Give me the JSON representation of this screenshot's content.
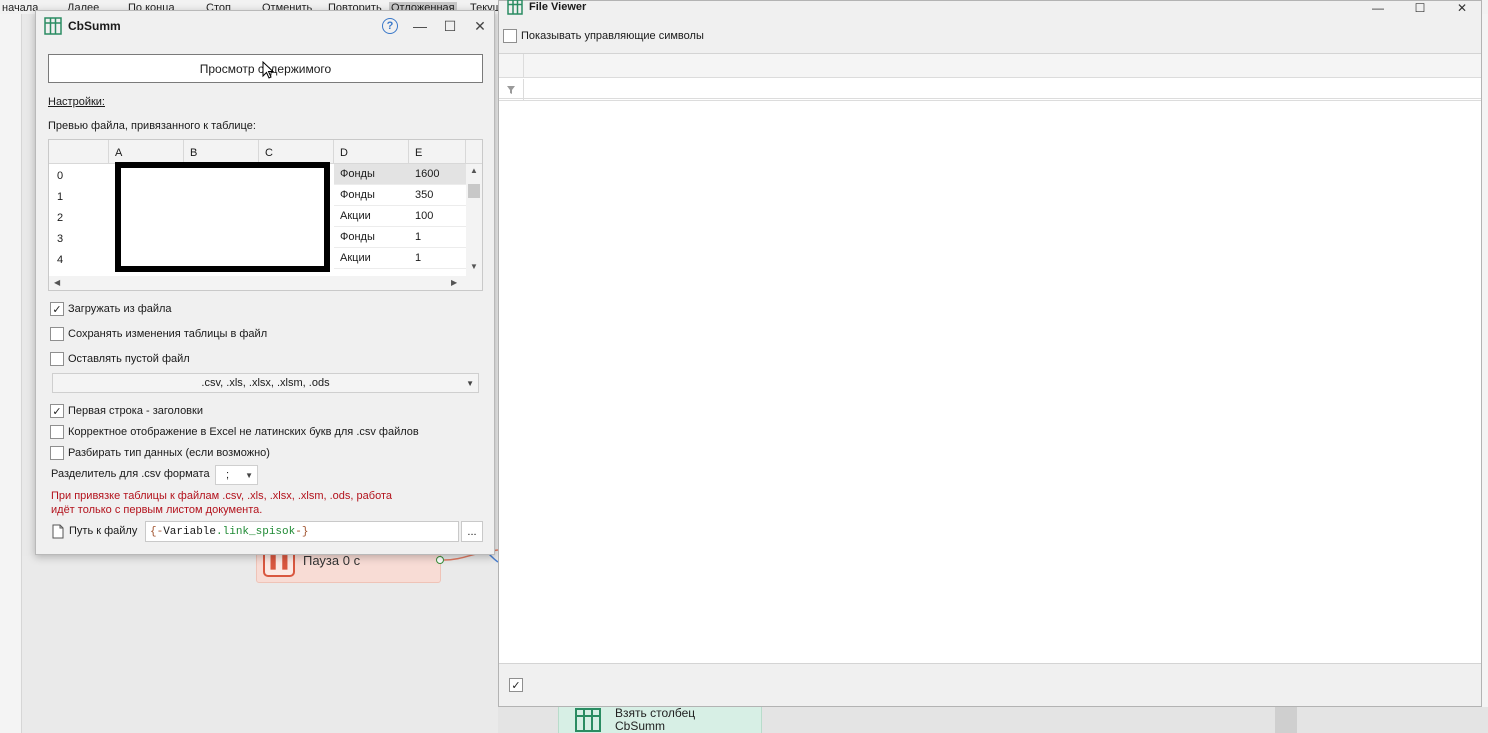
{
  "background": {
    "toolbar": [
      "начала",
      "Далее",
      "По конца",
      "Стоп",
      "Отменить",
      "Повторить",
      "Отложенная",
      "Текущ"
    ],
    "pause_block": {
      "label": "Пауза 0 с"
    },
    "take_block": {
      "line1": "Взять столбец",
      "line2": "CbSumm"
    }
  },
  "dialog": {
    "title": "CbSumm",
    "view_button": "Просмотр содержимого",
    "settings_link": "Настройки:",
    "preview_label": "Превью файла, привязанного к таблице:",
    "grid": {
      "columns": [
        "A",
        "B",
        "C",
        "D",
        "E"
      ],
      "rows": [
        {
          "idx": "0",
          "d": "Фонды",
          "e": "1600"
        },
        {
          "idx": "1",
          "d": "Фонды",
          "e": "350"
        },
        {
          "idx": "2",
          "d": "Акции",
          "e": "100"
        },
        {
          "idx": "3",
          "d": "Фонды",
          "e": "1"
        },
        {
          "idx": "4",
          "d": "Акции",
          "e": "1"
        }
      ]
    },
    "options": {
      "load_from_file": {
        "label": "Загружать из файла",
        "checked": true
      },
      "save_changes": {
        "label": "Сохранять изменения таблицы в файл",
        "checked": false
      },
      "leave_empty": {
        "label": "Оставлять пустой файл",
        "checked": false
      }
    },
    "format_combo": ".csv, .xls, .xlsx, .xlsm, .ods",
    "options2": {
      "first_row_headers": {
        "label": "Первая строка - заголовки",
        "checked": true
      },
      "excel_nonlatin": {
        "label": "Корректное отображение в Excel не латинских букв для .csv файлов",
        "checked": false
      },
      "parse_types": {
        "label": "Разбирать тип данных (если возможно)",
        "checked": false
      }
    },
    "separator_label": "Разделитель для .csv формата",
    "separator_value": ";",
    "warning_line1": "При привязке таблицы к файлам .csv, .xls, .xlsx, .xlsm, .ods, работа",
    "warning_line2": "идёт только с первым листом документа.",
    "path_label": "Путь к файлу",
    "path_value_open": "{-",
    "path_value_var": "Variable",
    "path_value_dot": ".",
    "path_value_name": "link_spisok",
    "path_value_close": "-}",
    "browse_label": "...",
    "check_glyph": "✓"
  },
  "viewer": {
    "title": "File Viewer",
    "show_control_chars": "Показывать управляющие символы",
    "footer_check_glyph": "✓"
  },
  "colors": {
    "accent_green": "#1f8a34",
    "warning_red": "#b3121c",
    "pause_orange": "#d9573f"
  }
}
